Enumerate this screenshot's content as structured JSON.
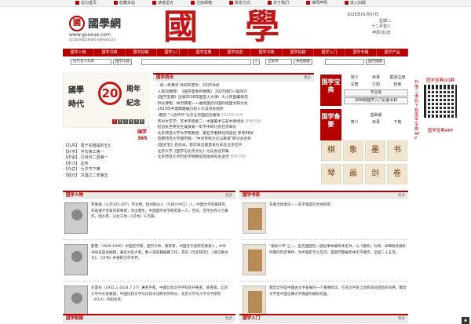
{
  "topbar": {
    "items": [
      "设为首页",
      "收藏本站",
      "读者留言",
      "注册邮箱",
      "联系方式",
      "关于我们",
      "律师声明",
      "进入旧版"
    ]
  },
  "header": {
    "logo_mark": "國",
    "logo_title": "國學網",
    "url": "www.guoxue.com",
    "phone": "(010)68429466  68900123",
    "calligraphy": "國學",
    "date": "2025年01月07日",
    "weekday": "星期二",
    "lunar": "十二月初八",
    "ganzhi": "甲辰(龙)年"
  },
  "nav": {
    "items": [
      "国学人物",
      "国学书苑",
      "国学投稿",
      "国学入门",
      "国学宝典",
      "国学动态",
      "国学书苑",
      "国学投稿",
      "国学入门",
      "国学专题",
      "国学产品"
    ]
  },
  "search": {
    "scope": "古代名人年表",
    "btn1": "国学工具",
    "scope2": "全部书",
    "btn2": "书名搜索",
    "btn3": "国学搜索"
  },
  "banner": {
    "line1": "國學",
    "line2": "時代",
    "seal": "20",
    "line3": "周年",
    "line4": "紀念",
    "pages": [
      "1",
      "2",
      "3",
      "4",
      "5",
      "6"
    ]
  },
  "g365": {
    "title": "国学365",
    "items": [
      "【孔丹】 周于先楷黑的五5",
      "【针字】 字句读工第一",
      "【中说】 只出月二首第一",
      "【学习】 左传",
      "【元亿】 七夕节下律",
      "【昭元】 甘酒之二年第五"
    ]
  },
  "news": {
    "title": "国学资讯",
    "more": "更多",
    "items": [
      {
        "t": "· 真一年黄华 件四年苦卦：2025你好",
        "d": ""
      },
      {
        "t": "人民同瑞网！《国学夏季到楼降》 2025我们一起同行",
        "d": ""
      },
      {
        "t": "《国学宝典》出版2018年国宝人文课！大人民国暑假前",
        "d": ""
      },
      {
        "t": "时光博物：林页期诸一一维修国近日国际组国文研讨会",
        "d": ""
      },
      {
        "t": "2023年中国典籍编力的十大读书会组织",
        "d": ""
      },
      {
        "t": "-曹圆 \"八达杯件\"北京主京国纪念播放",
        "d": "2023年12月"
      },
      {
        "t": "苏州文艺学：艺术伟晓第二：中国美术与非中新闻化",
        "d": "参考59岁"
      },
      {
        "t": "纪念张世英先生诞辰第一年学术研讨会在京举办",
        "d": ""
      },
      {
        "t": "北京师范大学文学院教授，著名学者韩兆琦逝世 参考88岁",
        "d": ""
      },
      {
        "t": "首都师范大学国学院：\"中华传统文化与教育\"研讨会召开",
        "d": ""
      },
      {
        "t": "《国文宝》启动本，影印本出版首发仪式在北京召开",
        "d": ""
      },
      {
        "t": "北京大学《国学与北京文化》论坛会议开幕",
        "d": ""
      },
      {
        "t": "北京师范大学历史学院教授晁福林先生逝世",
        "d": "参考79岁"
      }
    ]
  },
  "baodian": {
    "label1": "国学宝典",
    "label2": "国学备要",
    "label3": "国学智览",
    "row1": [
      "简介",
      "目录",
      "集团注册"
    ],
    "row2": [
      "注册",
      "订购",
      "检索"
    ],
    "edition1": "专业版",
    "btn1": "28种期国学入门必备书目",
    "edition2": "基础版",
    "row3": [
      "简介",
      "目录",
      "下载"
    ],
    "games": [
      "棋",
      "象",
      "墨",
      "书",
      "琴",
      "画",
      "剑",
      "卷"
    ]
  },
  "side": {
    "title": "国学宝典QQ群",
    "vert": "扫描二维码下载国学宝典APP",
    "app": "国学宝典APP"
  },
  "people": {
    "title": "国学人物",
    "more": "更多",
    "items": [
      "苏秦蔺（公元105-207）字文朗，桂州铜山人（今四川中江）人。中国文字先秦研究，先驱诸子百家先辈尊者，杰出儒生，中国国学史学研究第一人，百兄、苦宗生有十万著作，国乡民，以北三体，《汉书》十万篇。",
      "殷慧（1895-1990）中国史学家，国学大师，教育家。中国近代史研究奠基人，中华书局名誉总编辑，著名文史大家，数十部史籍编纂工作，其说《元史研究》、《满汉蒙古文》、《汉书》并被称为学术界。",
      "东夏石（1931.1-2024.7.27）著名学者。中国比较文学学科的开拓者，教育家。北京大学中文系教授，中国比较文学与比较文化研究所所长。北京大学与大学文学研究（ICLA）的副主席。"
    ]
  },
  "books": {
    "title": "国学书苑",
    "more": "更多",
    "items": [
      "先秦文体源流——史学角度的文体研究",
      "\"春秋三传\"之一，是先国国先一部纪事体编年体史书。以《春秋》为纲，详细叙述春秋时期的历史事件。为中国史学之先河，首部完整编年体史学著作。全部二十五卷。",
      "魏晋文学是中国古文学发展的一个重要阶段，它在文学史上具有承前启后的作用。魏晋文学是中国古典文学鼎盛时期的先驱。"
    ]
  },
  "bottom": {
    "left": "国学投稿",
    "right": "国学入门",
    "more": "更多"
  },
  "scroll_top": "▲"
}
